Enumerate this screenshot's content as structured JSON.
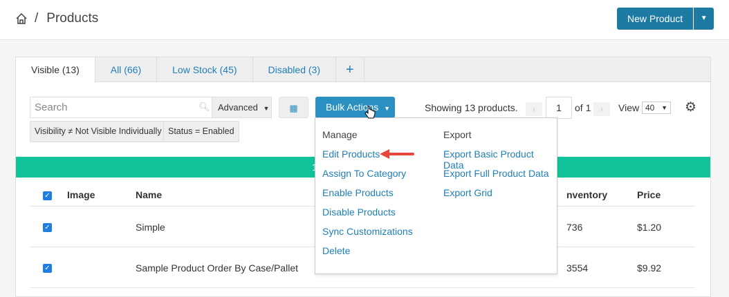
{
  "header": {
    "home_icon": "home-icon",
    "separator": "/",
    "title": "Products",
    "new_product": "New Product"
  },
  "tabs": [
    {
      "label": "Visible (13)",
      "active": true
    },
    {
      "label": "All (66)"
    },
    {
      "label": "Low Stock (45)"
    },
    {
      "label": "Disabled (3)"
    },
    {
      "label": "+",
      "icon": "plus-icon"
    }
  ],
  "toolbar": {
    "search_placeholder": "Search",
    "advanced": "Advanced",
    "bulk_actions": "Bulk Actions",
    "showing": "Showing 13 products.",
    "page": "1",
    "of": "of 1",
    "view_label": "View",
    "view_value": "40"
  },
  "filters": [
    "Visibility ≠ Not Visible Individually",
    "Status = Enabled"
  ],
  "banner": {
    "text": "1",
    "color": "#10c39a"
  },
  "table": {
    "headers": {
      "image": "Image",
      "name": "Name",
      "inventory": "nventory",
      "price": "Price"
    },
    "rows": [
      {
        "name": "Simple",
        "inventory": "736",
        "price": "$1.20"
      },
      {
        "name": "Sample Product Order By Case/Pallet",
        "inventory": "3554",
        "price": "$9.92"
      }
    ]
  },
  "menu": {
    "manage_header": "Manage",
    "manage": [
      "Edit Products",
      "Assign To Category",
      "Enable Products",
      "Disable Products",
      "Sync Customizations",
      "Delete"
    ],
    "export_header": "Export",
    "export": [
      "Export Basic Product Data",
      "Export Full Product Data",
      "Export Grid"
    ]
  },
  "colors": {
    "primary": "#1d7aa3",
    "bulk": "#2a8fc1",
    "link": "#1f7eb5",
    "arrow": "#e8453c"
  }
}
